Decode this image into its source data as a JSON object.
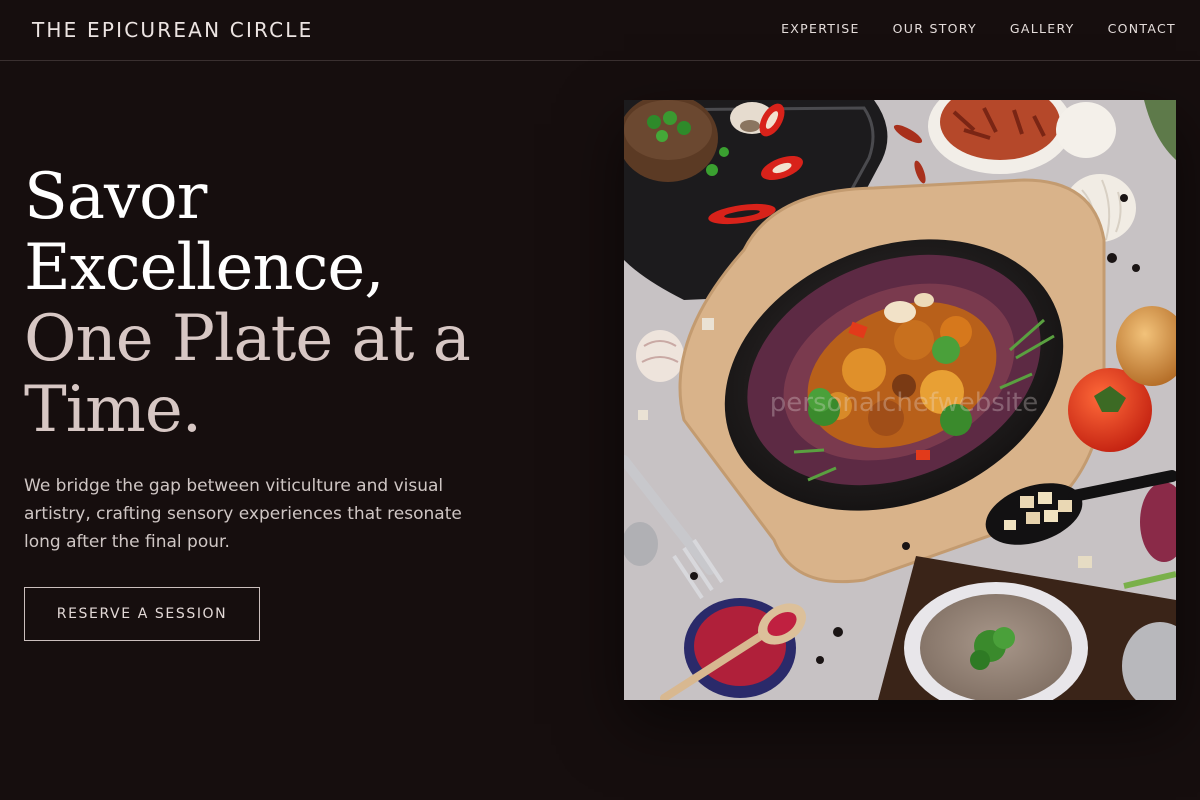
{
  "header": {
    "brand": "THE EPICUREAN CIRCLE",
    "nav": [
      "EXPERTISE",
      "OUR STORY",
      "GALLERY",
      "CONTACT"
    ]
  },
  "hero": {
    "title_line1": "Savor Excellence,",
    "title_line2": "One Plate at a Time.",
    "description": "We bridge the gap between viticulture and visual artistry, crafting sensory experiences that resonate long after the final pour.",
    "cta_label": "RESERVE A SESSION"
  },
  "image": {
    "alt": "Overhead view of a skillet dish with vegetables, spices and soup",
    "watermark": "personalchefwebsite"
  },
  "colors": {
    "background": "#160e0e",
    "title_primary": "#ffffff",
    "title_secondary": "#d7c7c4",
    "text_muted": "#cfc6c4"
  }
}
